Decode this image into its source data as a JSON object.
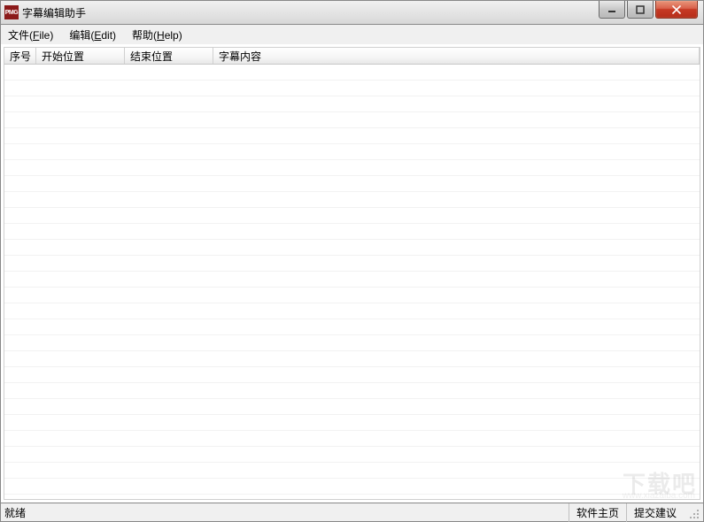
{
  "window": {
    "title": "字幕编辑助手",
    "icon_text": "PMG"
  },
  "menu": {
    "file_prefix": "文件(",
    "file_mnemonic": "F",
    "file_suffix": "ile)",
    "edit_prefix": "编辑(",
    "edit_mnemonic": "E",
    "edit_suffix": "dit)",
    "help_prefix": "帮助(",
    "help_mnemonic": "H",
    "help_suffix": "elp)"
  },
  "columns": {
    "seq": "序号",
    "start": "开始位置",
    "end": "结束位置",
    "content": "字幕内容"
  },
  "status": {
    "ready": "就绪",
    "homepage": "软件主页",
    "feedback": "提交建议"
  },
  "watermark": {
    "main": "下载吧",
    "sub": "www.xiazaiba.com"
  }
}
